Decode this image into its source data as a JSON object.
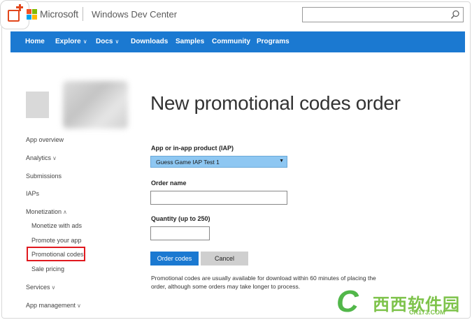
{
  "header": {
    "brand": "Microsoft",
    "site_title": "Windows Dev Center",
    "search_placeholder": ""
  },
  "nav": {
    "items": [
      {
        "label": "Home",
        "dropdown": false
      },
      {
        "label": "Explore",
        "dropdown": true
      },
      {
        "label": "Docs",
        "dropdown": true
      },
      {
        "label": "Downloads",
        "dropdown": false
      },
      {
        "label": "Samples",
        "dropdown": false
      },
      {
        "label": "Community",
        "dropdown": false
      },
      {
        "label": "Programs",
        "dropdown": false
      }
    ],
    "chevron": "∨"
  },
  "sidebar": {
    "items": [
      {
        "label": "App overview"
      },
      {
        "label": "Analytics",
        "chevron": "∨"
      },
      {
        "label": "Submissions"
      },
      {
        "label": "IAPs"
      },
      {
        "label": "Monetization",
        "chevron": "∧"
      },
      {
        "label": "Monetize with ads"
      },
      {
        "label": "Promote your app"
      },
      {
        "label": "Promotional codes"
      },
      {
        "label": "Sale pricing"
      },
      {
        "label": "Services",
        "chevron": "∨"
      },
      {
        "label": "App management",
        "chevron": "∨"
      }
    ],
    "active": "Promotional codes"
  },
  "main": {
    "title": "New promotional codes order",
    "product_label": "App or in-app product (IAP)",
    "product_value": "Guess Game IAP Test 1",
    "order_name_label": "Order name",
    "order_name_value": "",
    "quantity_label": "Quantity (up to 250)",
    "quantity_value": "",
    "order_button": "Order codes",
    "cancel_button": "Cancel",
    "note": "Promotional codes are usually available for download within 60 minutes of placing the order, although some orders may take longer to process."
  },
  "watermark": {
    "text": "西西软件园",
    "url": "CR173.COM"
  },
  "colors": {
    "nav_bg": "#1b79d1",
    "primary_button": "#1b79d1",
    "select_bg": "#8ec7f2",
    "active_outline": "#e0191f"
  }
}
